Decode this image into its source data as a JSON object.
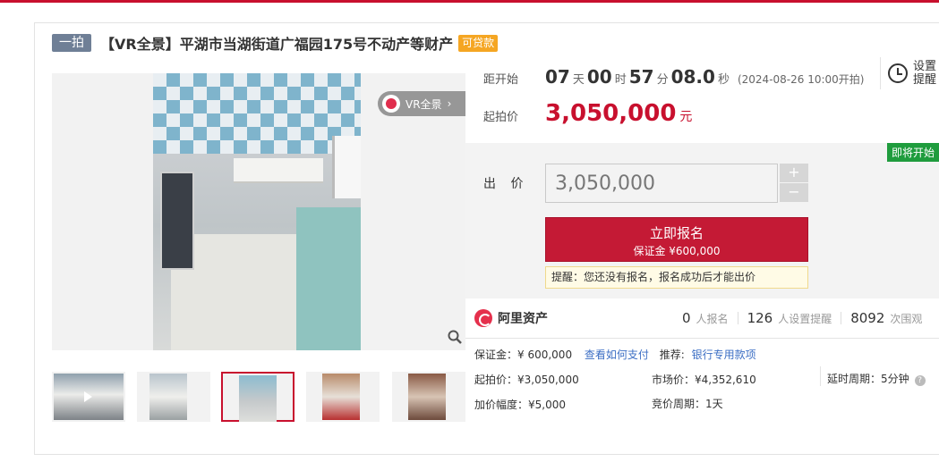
{
  "header": {
    "tag": "一拍",
    "title": "【VR全景】平湖市当湖街道广福园175号不动产等财产",
    "loan_tag": "可贷款"
  },
  "gallery": {
    "vr_label": "VR全景",
    "thumbnails": [
      "thumb-1-video",
      "thumb-2",
      "thumb-3",
      "thumb-4",
      "thumb-5"
    ],
    "active_index": 2
  },
  "countdown": {
    "label": "距开始",
    "days": "07",
    "day_unit": "天",
    "hours": "00",
    "hour_unit": "时",
    "minutes": "57",
    "minute_unit": "分",
    "seconds": "08.0",
    "second_unit": "秒",
    "start_note": "(2024-08-26 10:00开拍)"
  },
  "reminder": {
    "label": "设置提醒"
  },
  "start_price": {
    "label": "起拍价",
    "value": "3,050,000",
    "unit": "元"
  },
  "bid": {
    "status_badge": "即将开始",
    "label": "出 价",
    "value": "3,050,000",
    "plus": "+",
    "minus": "−",
    "signup_label": "立即报名",
    "deposit_line": "保证金 ¥600,000",
    "tip": "提醒：您还没有报名，报名成功后才能出价"
  },
  "stats": {
    "brand": "阿里资产",
    "signups": "0",
    "signups_label": "人报名",
    "reminders": "126",
    "reminders_label": "人设置提醒",
    "views": "8092",
    "views_label": "次围观"
  },
  "details": {
    "deposit_label": "保证金：¥ 600,000",
    "pay_link": "查看如何支付",
    "recommend_label": "推荐:",
    "recommend_link": "银行专用款项",
    "start_price": "起拍价：¥3,050,000",
    "market_price": "市场价：¥4,352,610",
    "delay_period": "延时周期：5分钟",
    "increment": "加价幅度：¥5,000",
    "bid_period": "竞价周期：1天"
  },
  "colors": {
    "accent": "#c8102e",
    "badge_green": "#1f9c3d",
    "loan_orange": "#f5a623",
    "link_blue": "#3d6fc4"
  }
}
